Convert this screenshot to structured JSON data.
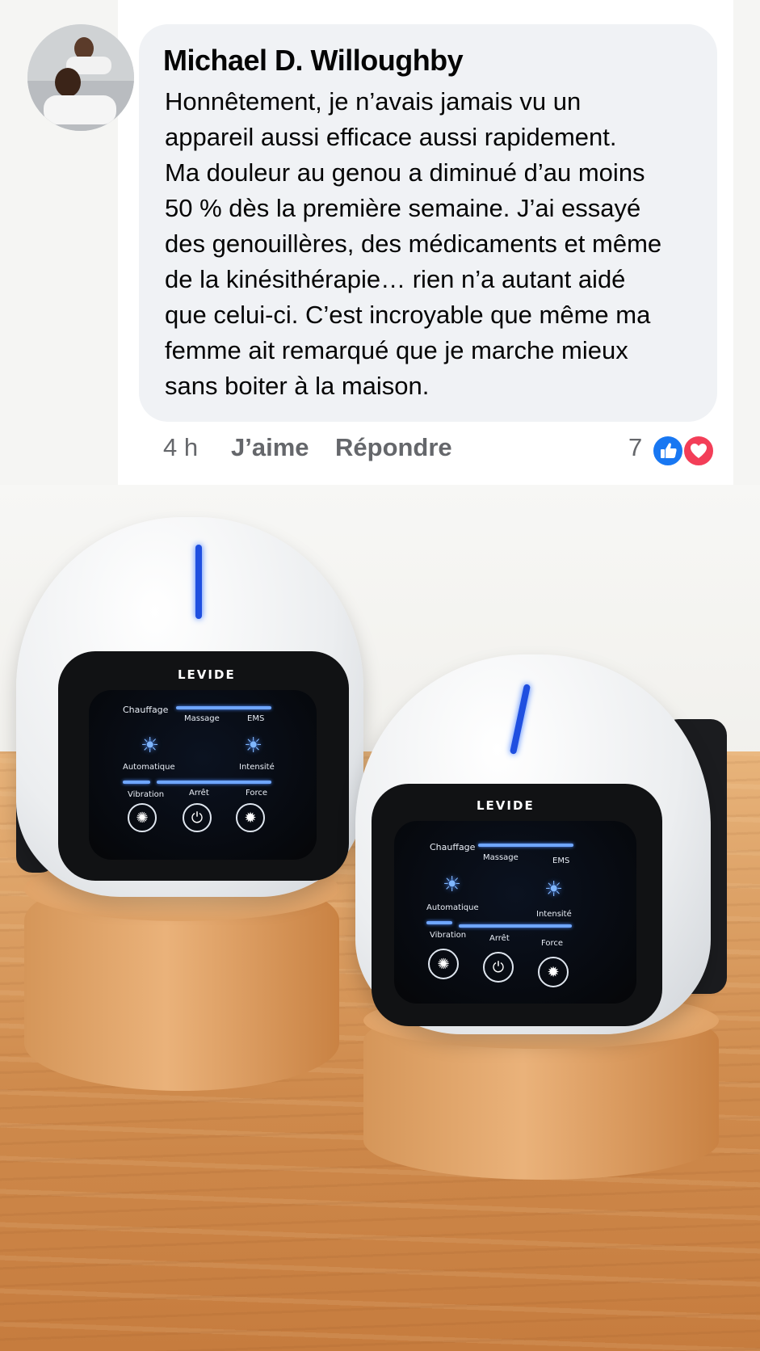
{
  "comment": {
    "author": "Michael D. Willoughby",
    "text_lines": [
      "Honnêtement, je n’avais jamais vu un",
      "appareil aussi efficace aussi rapidement.",
      "Ma douleur au genou a diminué d’au moins",
      "50 % dès la première semaine. J’ai essayé",
      "des genouillères, des médicaments et même",
      "de la kinésithérapie… rien n’a autant aidé",
      "que celui-ci. C’est incroyable que même ma",
      "femme ait remarqué que je marche mieux",
      "sans boiter à la maison."
    ],
    "time": "4 h",
    "like_label": "J’aime",
    "reply_label": "Répondre",
    "reaction_count": "7",
    "reactions": [
      "thumbs-up-icon",
      "heart-icon"
    ],
    "colors": {
      "like": "#1877f2",
      "love": "#f33e58",
      "bubble": "#f0f2f5",
      "meta": "#65676b"
    }
  },
  "product": {
    "brand": "LEVIDE",
    "panel": {
      "heat": "Chauffage",
      "massage": "Massage",
      "ems": "EMS",
      "auto": "Automatique",
      "intensity": "Intensité",
      "vibration": "Vibration",
      "stop": "Arrêt",
      "force": "Force"
    },
    "led_color": "#1f4fe0"
  }
}
